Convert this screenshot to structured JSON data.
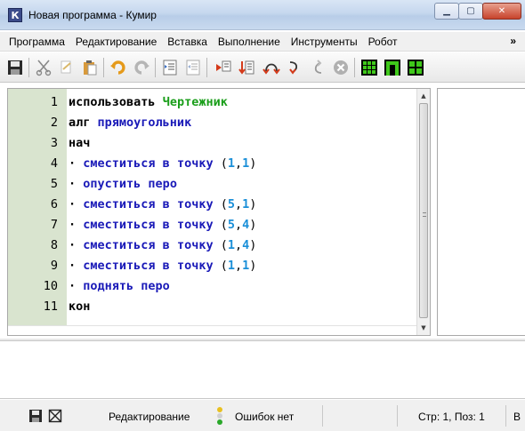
{
  "window": {
    "title": "Новая программа - Кумир",
    "icon_letter": "К"
  },
  "menu": [
    "Программа",
    "Редактирование",
    "Вставка",
    "Выполнение",
    "Инструменты",
    "Робот"
  ],
  "menu_more": "»",
  "editor": {
    "lines": [
      {
        "n": "1"
      },
      {
        "n": "2"
      },
      {
        "n": "3"
      },
      {
        "n": "4"
      },
      {
        "n": "5"
      },
      {
        "n": "6"
      },
      {
        "n": "7"
      },
      {
        "n": "8"
      },
      {
        "n": "9"
      },
      {
        "n": "10"
      },
      {
        "n": "11"
      }
    ],
    "tokens": {
      "use": "использовать",
      "lib": "Чертежник",
      "alg": "алг",
      "alg_name": "прямоугольник",
      "begin": "нач",
      "move": "сместиться в точку",
      "pen_down": "опустить перо",
      "pen_up": "поднять перо",
      "end": "кон",
      "dot": "·"
    },
    "points": [
      {
        "x": "1",
        "y": "1"
      },
      {
        "x": "5",
        "y": "1"
      },
      {
        "x": "5",
        "y": "4"
      },
      {
        "x": "1",
        "y": "4"
      },
      {
        "x": "1",
        "y": "1"
      }
    ]
  },
  "status": {
    "mode": "Редактирование",
    "errors": "Ошибок нет",
    "position": "Стр: 1, Поз: 1",
    "extra": "В"
  },
  "colors": {
    "gutter": "#d9e4cf",
    "keyword_blue": "#1a1ab8",
    "lib_green": "#1a9e1a",
    "number_blue": "#1a8fd8"
  }
}
